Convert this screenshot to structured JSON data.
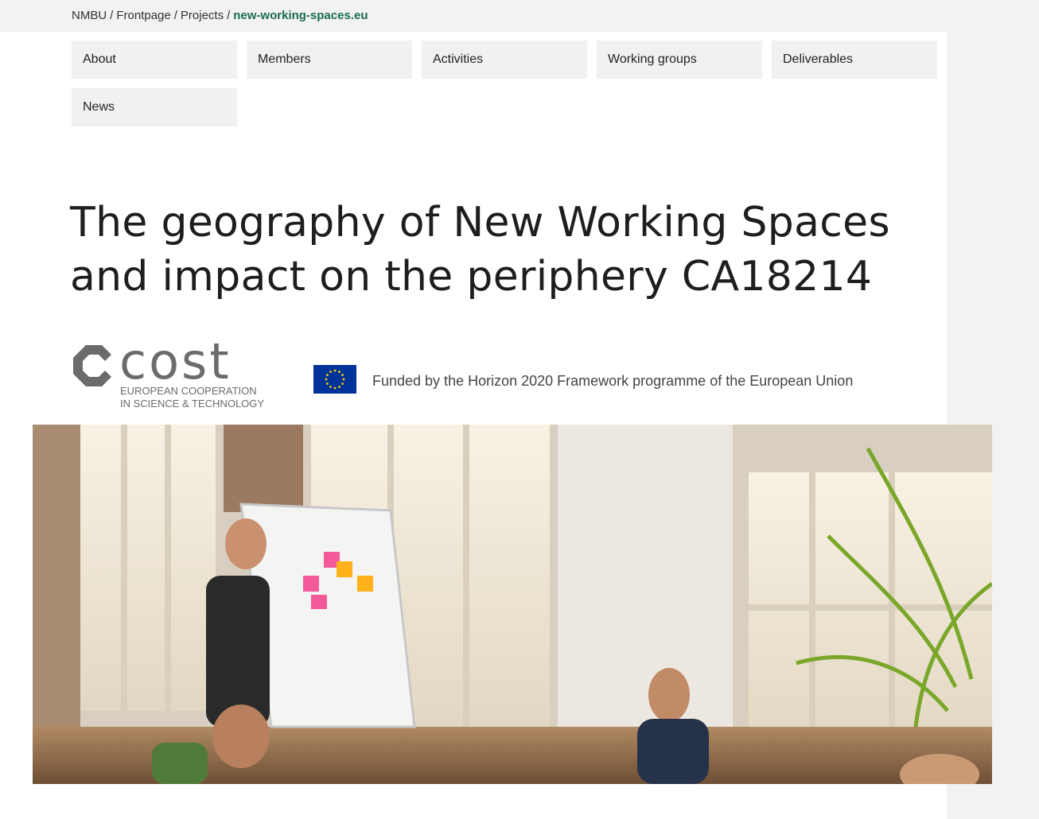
{
  "breadcrumb": {
    "items": [
      "NMBU",
      "Frontpage",
      "Projects"
    ],
    "separator": "/",
    "current": "new-working-spaces.eu"
  },
  "nav": {
    "items": [
      "About",
      "Members",
      "Activities",
      "Working groups",
      "Deliverables",
      "News"
    ]
  },
  "page_title": "The geography of New Working Spaces and impact on the periphery CA18214",
  "cost_logo": {
    "wordmark": "cost",
    "line1": "EUROPEAN COOPERATION",
    "line2": "IN SCIENCE & TECHNOLOGY"
  },
  "funding": {
    "text": "Funded by the Horizon 2020 Framework programme of the European Union"
  },
  "colors": {
    "accent_link": "#1a6d4b",
    "eu_blue": "#003399",
    "eu_gold": "#ffcc00",
    "nav_background": "#f1f1f1"
  },
  "icons": {
    "cost_mark": "cost-logo-icon",
    "eu_flag": "eu-flag-icon"
  }
}
